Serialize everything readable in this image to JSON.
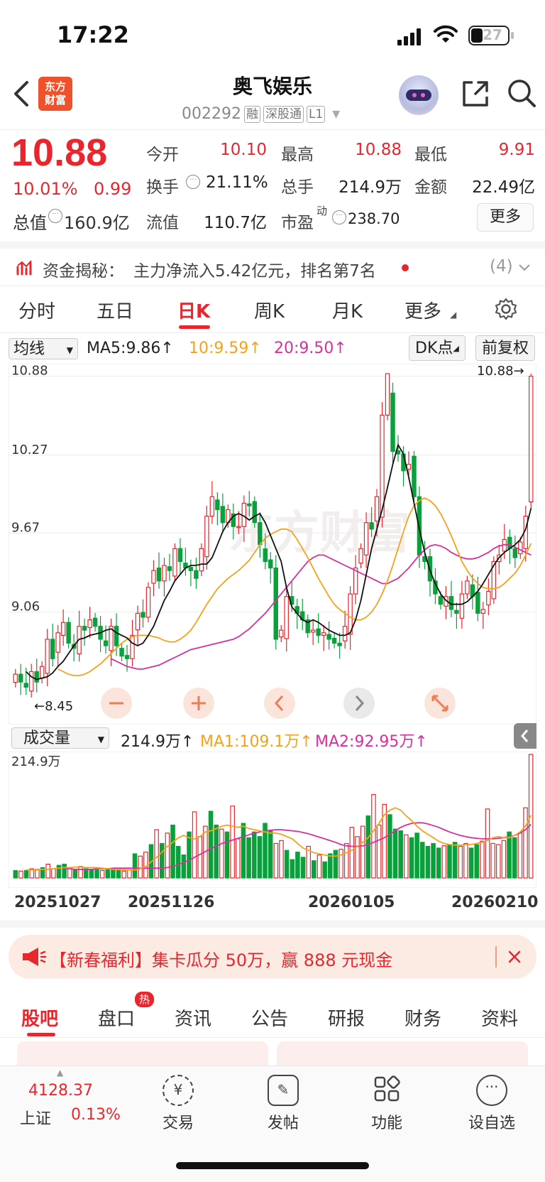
{
  "status": {
    "time": "17:22",
    "battery": "27"
  },
  "header": {
    "logo_line1": "东方",
    "logo_line2": "财富",
    "title": "奥飞娱乐",
    "code": "002292",
    "tags": [
      "融",
      "深股通",
      "L1"
    ]
  },
  "quote": {
    "price": "10.88",
    "pct": "10.01%",
    "change": "0.99",
    "open_label": "今开",
    "open": "10.10",
    "high_label": "最高",
    "high": "10.88",
    "low_label": "最低",
    "low": "9.91",
    "turnover_label": "换手",
    "turnover": "21.11%",
    "volume_label": "总手",
    "volume": "214.9万",
    "amount_label": "金额",
    "amount": "22.49亿",
    "mcap_label": "总值",
    "mcap": "160.9亿",
    "float_label": "流值",
    "float": "110.7亿",
    "pe_label": "市盈",
    "pe_sup": "动",
    "pe": "238.70",
    "more": "更多"
  },
  "fund": {
    "label": "资金揭秘：",
    "text": "主力净流入5.42亿元，排名第7名",
    "count": "(4)"
  },
  "tabs": [
    "分时",
    "五日",
    "日K",
    "周K",
    "月K",
    "更多"
  ],
  "indicator": {
    "select": "均线",
    "ma5": "MA5:9.86↑",
    "ma10": "10:9.59↑",
    "ma20": "20:9.50↑",
    "dk": "DK点",
    "adjust": "前复权"
  },
  "volume_panel": {
    "select": "成交量",
    "vol": "214.9万↑",
    "ma1": "MA1:109.1万↑",
    "ma2": "MA2:92.95万↑",
    "max_label": "214.9万"
  },
  "chart_data": [
    {
      "type": "candlestick",
      "title": "",
      "y_ticks": [
        "10.88",
        "10.27",
        "9.67",
        "9.06"
      ],
      "ylim": [
        8.4,
        10.9
      ],
      "annotations": {
        "max_label": "10.88→",
        "min_label": "←8.45"
      },
      "legend": [
        "MA5:9.86↑",
        "10:9.59↑",
        "20:9.50↑"
      ],
      "x_ticks": [
        "20251027",
        "20251126",
        "20260105",
        "20260210"
      ],
      "close": [
        8.58,
        8.52,
        8.48,
        8.6,
        8.52,
        8.64,
        8.85,
        8.7,
        8.9,
        8.98,
        8.82,
        8.78,
        8.95,
        8.92,
        9.0,
        8.95,
        8.85,
        8.8,
        8.95,
        8.8,
        8.72,
        8.7,
        8.88,
        9.05,
        9.02,
        9.25,
        9.38,
        9.3,
        9.42,
        9.38,
        9.55,
        9.45,
        9.4,
        9.38,
        9.32,
        9.55,
        9.8,
        9.95,
        9.85,
        9.75,
        9.85,
        9.72,
        9.72,
        9.9,
        9.88,
        9.75,
        9.58,
        9.45,
        9.4,
        8.85,
        8.92,
        9.18,
        9.12,
        9.05,
        9.0,
        8.9,
        8.92,
        8.88,
        8.9,
        8.85,
        8.82,
        8.8,
        8.95,
        9.2,
        9.4,
        9.55,
        9.75,
        9.7,
        9.95,
        10.58,
        10.9,
        10.3,
        10.28,
        10.15,
        10.2,
        9.95,
        9.5,
        9.45,
        9.3,
        9.2,
        9.12,
        9.18,
        9.08,
        9.05,
        9.2,
        9.3,
        9.18,
        9.05,
        9.08,
        9.22,
        9.45,
        9.5,
        9.62,
        9.55,
        9.48,
        9.6,
        9.8,
        10.88
      ],
      "ma5": [
        8.6,
        8.56,
        8.54,
        8.55,
        8.56,
        8.59,
        8.64,
        8.68,
        8.74,
        8.8,
        8.85,
        8.86,
        8.88,
        8.89,
        8.9,
        8.92,
        8.93,
        8.9,
        8.88,
        8.86,
        8.82,
        8.8,
        8.82,
        8.88,
        8.95,
        9.05,
        9.15,
        9.22,
        9.3,
        9.35,
        9.4,
        9.42,
        9.42,
        9.43,
        9.43,
        9.48,
        9.58,
        9.68,
        9.75,
        9.8,
        9.82,
        9.8,
        9.77,
        9.8,
        9.82,
        9.75,
        9.65,
        9.55,
        9.45,
        9.25,
        9.1,
        9.05,
        9.0,
        8.98,
        9.0,
        8.98,
        8.95,
        8.92,
        8.9,
        8.88,
        8.88,
        8.9,
        9.0,
        9.15,
        9.35,
        9.55,
        9.7,
        9.85,
        10.02,
        10.2,
        10.35,
        10.28,
        10.1,
        9.9,
        9.7,
        9.52,
        9.38,
        9.28,
        9.2,
        9.15,
        9.12,
        9.12,
        9.12,
        9.14,
        9.18,
        9.22,
        9.28,
        9.35,
        9.42,
        9.48,
        9.52,
        9.55,
        9.58,
        9.62,
        9.7,
        9.86
      ],
      "ma10": [
        8.62,
        8.6,
        8.58,
        8.57,
        8.57,
        8.58,
        8.6,
        8.63,
        8.66,
        8.7,
        8.74,
        8.78,
        8.82,
        8.85,
        8.87,
        8.88,
        8.88,
        8.88,
        8.87,
        8.86,
        8.84,
        8.83,
        8.83,
        8.85,
        8.88,
        8.92,
        8.98,
        9.05,
        9.12,
        9.18,
        9.24,
        9.28,
        9.32,
        9.35,
        9.38,
        9.42,
        9.46,
        9.52,
        9.58,
        9.63,
        9.66,
        9.68,
        9.7,
        9.7,
        9.68,
        9.62,
        9.55,
        9.48,
        9.4,
        9.32,
        9.25,
        9.18,
        9.12,
        9.08,
        9.05,
        9.02,
        9.0,
        9.0,
        9.02,
        9.06,
        9.12,
        9.2,
        9.3,
        9.42,
        9.55,
        9.68,
        9.8,
        9.88,
        9.92,
        9.94,
        9.92,
        9.88,
        9.82,
        9.74,
        9.65,
        9.55,
        9.45,
        9.38,
        9.32,
        9.28,
        9.25,
        9.24,
        9.24,
        9.25,
        9.28,
        9.32,
        9.36,
        9.42,
        9.5,
        9.59
      ],
      "ma20": [
        8.7,
        8.68,
        8.66,
        8.64,
        8.63,
        8.62,
        8.62,
        8.63,
        8.64,
        8.65,
        8.67,
        8.69,
        8.71,
        8.73,
        8.75,
        8.77,
        8.78,
        8.79,
        8.8,
        8.81,
        8.82,
        8.83,
        8.84,
        8.85,
        8.87,
        8.9,
        8.93,
        8.97,
        9.01,
        9.05,
        9.1,
        9.15,
        9.2,
        9.25,
        9.3,
        9.35,
        9.4,
        9.45,
        9.48,
        9.5,
        9.5,
        9.48,
        9.46,
        9.44,
        9.42,
        9.4,
        9.38,
        9.36,
        9.34,
        9.32,
        9.3,
        9.28,
        9.28,
        9.3,
        9.32,
        9.36,
        9.4,
        9.45,
        9.5,
        9.54,
        9.57,
        9.58,
        9.57,
        9.55,
        9.52,
        9.5,
        9.48,
        9.47,
        9.47,
        9.48,
        9.5,
        9.52,
        9.55,
        9.57,
        9.58,
        9.58,
        9.56,
        9.54,
        9.52,
        9.5
      ]
    },
    {
      "type": "bar",
      "title": "",
      "y_ticks": [
        "214.9万"
      ],
      "legend": [
        "214.9万↑",
        "MA1:109.1万↑",
        "MA2:92.95万↑"
      ],
      "unit": "万",
      "values": [
        13,
        12,
        13,
        16,
        15,
        18,
        24,
        16,
        22,
        24,
        18,
        15,
        20,
        16,
        15,
        14,
        13,
        16,
        14,
        13,
        12,
        14,
        42,
        38,
        45,
        58,
        84,
        60,
        78,
        92,
        55,
        40,
        80,
        115,
        72,
        90,
        116,
        92,
        85,
        80,
        125,
        68,
        95,
        70,
        80,
        72,
        95,
        82,
        60,
        65,
        48,
        32,
        45,
        36,
        55,
        30,
        40,
        28,
        42,
        48,
        50,
        60,
        88,
        72,
        90,
        108,
        145,
        92,
        128,
        110,
        85,
        82,
        75,
        70,
        78,
        62,
        55,
        60,
        52,
        56,
        58,
        62,
        55,
        60,
        52,
        58,
        64,
        120,
        60,
        58,
        65,
        80,
        70,
        78,
        122,
        214.9
      ],
      "ma1": [
        14,
        14,
        14,
        15,
        15,
        16,
        17,
        18,
        18,
        19,
        19,
        18,
        18,
        18,
        17,
        16,
        15,
        15,
        14,
        14,
        14,
        16,
        20,
        28,
        36,
        45,
        55,
        62,
        70,
        74,
        70,
        68,
        72,
        80,
        82,
        86,
        90,
        92,
        90,
        88,
        90,
        86,
        84,
        82,
        80,
        78,
        78,
        76,
        72,
        68,
        60,
        52,
        48,
        44,
        42,
        40,
        38,
        38,
        40,
        44,
        48,
        55,
        62,
        70,
        82,
        95,
        110,
        118,
        122,
        118,
        108,
        100,
        90,
        82,
        76,
        70,
        64,
        60,
        58,
        57,
        57,
        58,
        58,
        60,
        62,
        65,
        70,
        72,
        70,
        70,
        74,
        80,
        90,
        109.1
      ],
      "ma2": [
        16,
        16,
        15,
        15,
        15,
        15,
        16,
        16,
        16,
        17,
        17,
        17,
        17,
        17,
        17,
        17,
        17,
        17,
        17,
        18,
        20,
        23,
        27,
        31,
        36,
        41,
        46,
        51,
        55,
        60,
        63,
        66,
        69,
        72,
        75,
        78,
        80,
        82,
        83,
        84,
        84,
        83,
        82,
        81,
        79,
        77,
        74,
        71,
        68,
        65,
        62,
        58,
        56,
        55,
        55,
        56,
        58,
        62,
        66,
        70,
        76,
        82,
        88,
        92,
        95,
        96,
        96,
        94,
        91,
        88,
        84,
        80,
        77,
        74,
        72,
        70,
        69,
        68,
        68,
        68,
        69,
        70,
        72,
        74,
        78,
        84,
        92.95
      ]
    }
  ],
  "banner": {
    "text": "【新春福利】集卡瓜分 50万，赢 888 元现金"
  },
  "bottom_tabs": [
    "股吧",
    "盘口",
    "资讯",
    "公告",
    "研报",
    "财务",
    "资料"
  ],
  "hot_badge": "热",
  "nav": {
    "index_value": "4128.37",
    "index_name": "上证",
    "index_pct": "0.13%",
    "items": [
      "交易",
      "发帖",
      "功能",
      "设自选"
    ]
  }
}
